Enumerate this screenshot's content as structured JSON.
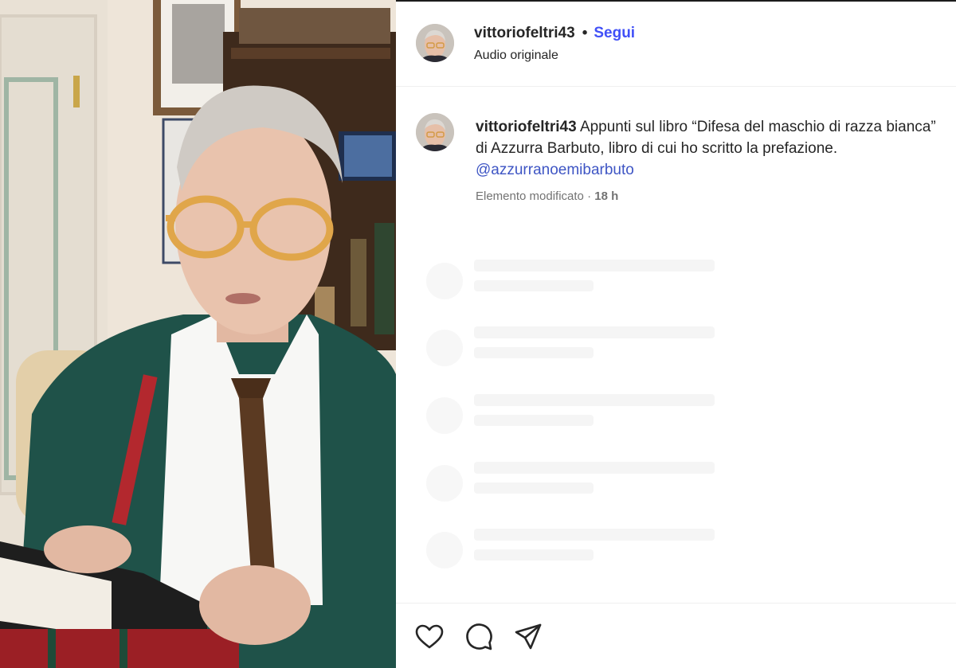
{
  "post": {
    "username": "vittoriofeltri43",
    "separator": "•",
    "follow_label": "Segui",
    "audio_label": "Audio originale"
  },
  "caption": {
    "username": "vittoriofeltri43",
    "text": "Appunti sul libro “Difesa del maschio di razza bianca” di Azzurra Barbuto, libro di cui ho scritto la prefazione.",
    "mention": "@azzurranoemibarbuto",
    "edited_label": "Elemento modificato",
    "meta_separator": " · ",
    "time": "18 h"
  },
  "comments_loading": {
    "placeholder_rows": 5
  },
  "actions": {
    "icons": [
      "heart-icon",
      "comment-icon",
      "share-icon"
    ]
  },
  "colors": {
    "follow_blue": "#4150f7",
    "mention_blue": "#3e55c4",
    "meta_gray": "#737373",
    "text": "#262626"
  }
}
